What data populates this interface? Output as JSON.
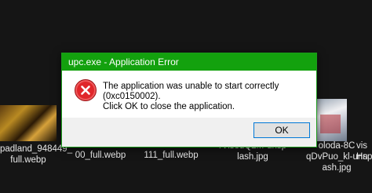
{
  "dialog": {
    "title": "upc.exe - Application Error",
    "message_line1": "The application was unable to start correctly (0xc0150002).",
    "message_line2": "Click OK to close the application.",
    "ok_label": "OK",
    "icon": "error-icon"
  },
  "background_files": [
    {
      "line1": "padland_948449_",
      "line2": "full.webp"
    },
    {
      "line1": "00_full.webp",
      "line2": ""
    },
    {
      "line1": "111_full.webp",
      "line2": ""
    },
    {
      "line1": "rVisodQ2M-unsp",
      "line2": "lash.jpg"
    },
    {
      "line1": "oloda-8C",
      "line2": "qDvPuo_kl-unspl",
      "line3": "ash.jpg"
    },
    {
      "line1": "vis",
      "line2": "Hn"
    }
  ],
  "colors": {
    "titlebar": "#13a10e",
    "desktop": "#151515",
    "error_red": "#e0262a"
  }
}
